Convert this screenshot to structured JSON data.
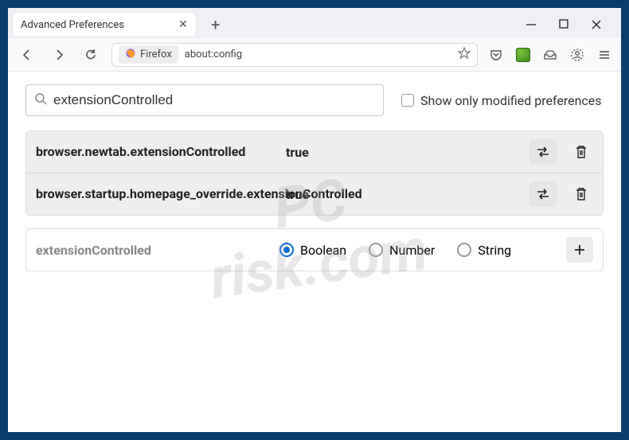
{
  "window": {
    "tab_title": "Advanced Preferences"
  },
  "toolbar": {
    "address_chip": "Firefox",
    "address": "about:config"
  },
  "search": {
    "value": "extensionControlled",
    "show_modified_label": "Show only modified preferences"
  },
  "prefs": [
    {
      "name": "browser.newtab.extensionControlled",
      "value": "true"
    },
    {
      "name": "browser.startup.homepage_override.extensionControlled",
      "value": "true"
    }
  ],
  "add_row": {
    "name": "extensionControlled",
    "options": [
      "Boolean",
      "Number",
      "String"
    ],
    "selected": "Boolean"
  },
  "watermark": {
    "line1": "PC",
    "line2": "risk.com"
  }
}
